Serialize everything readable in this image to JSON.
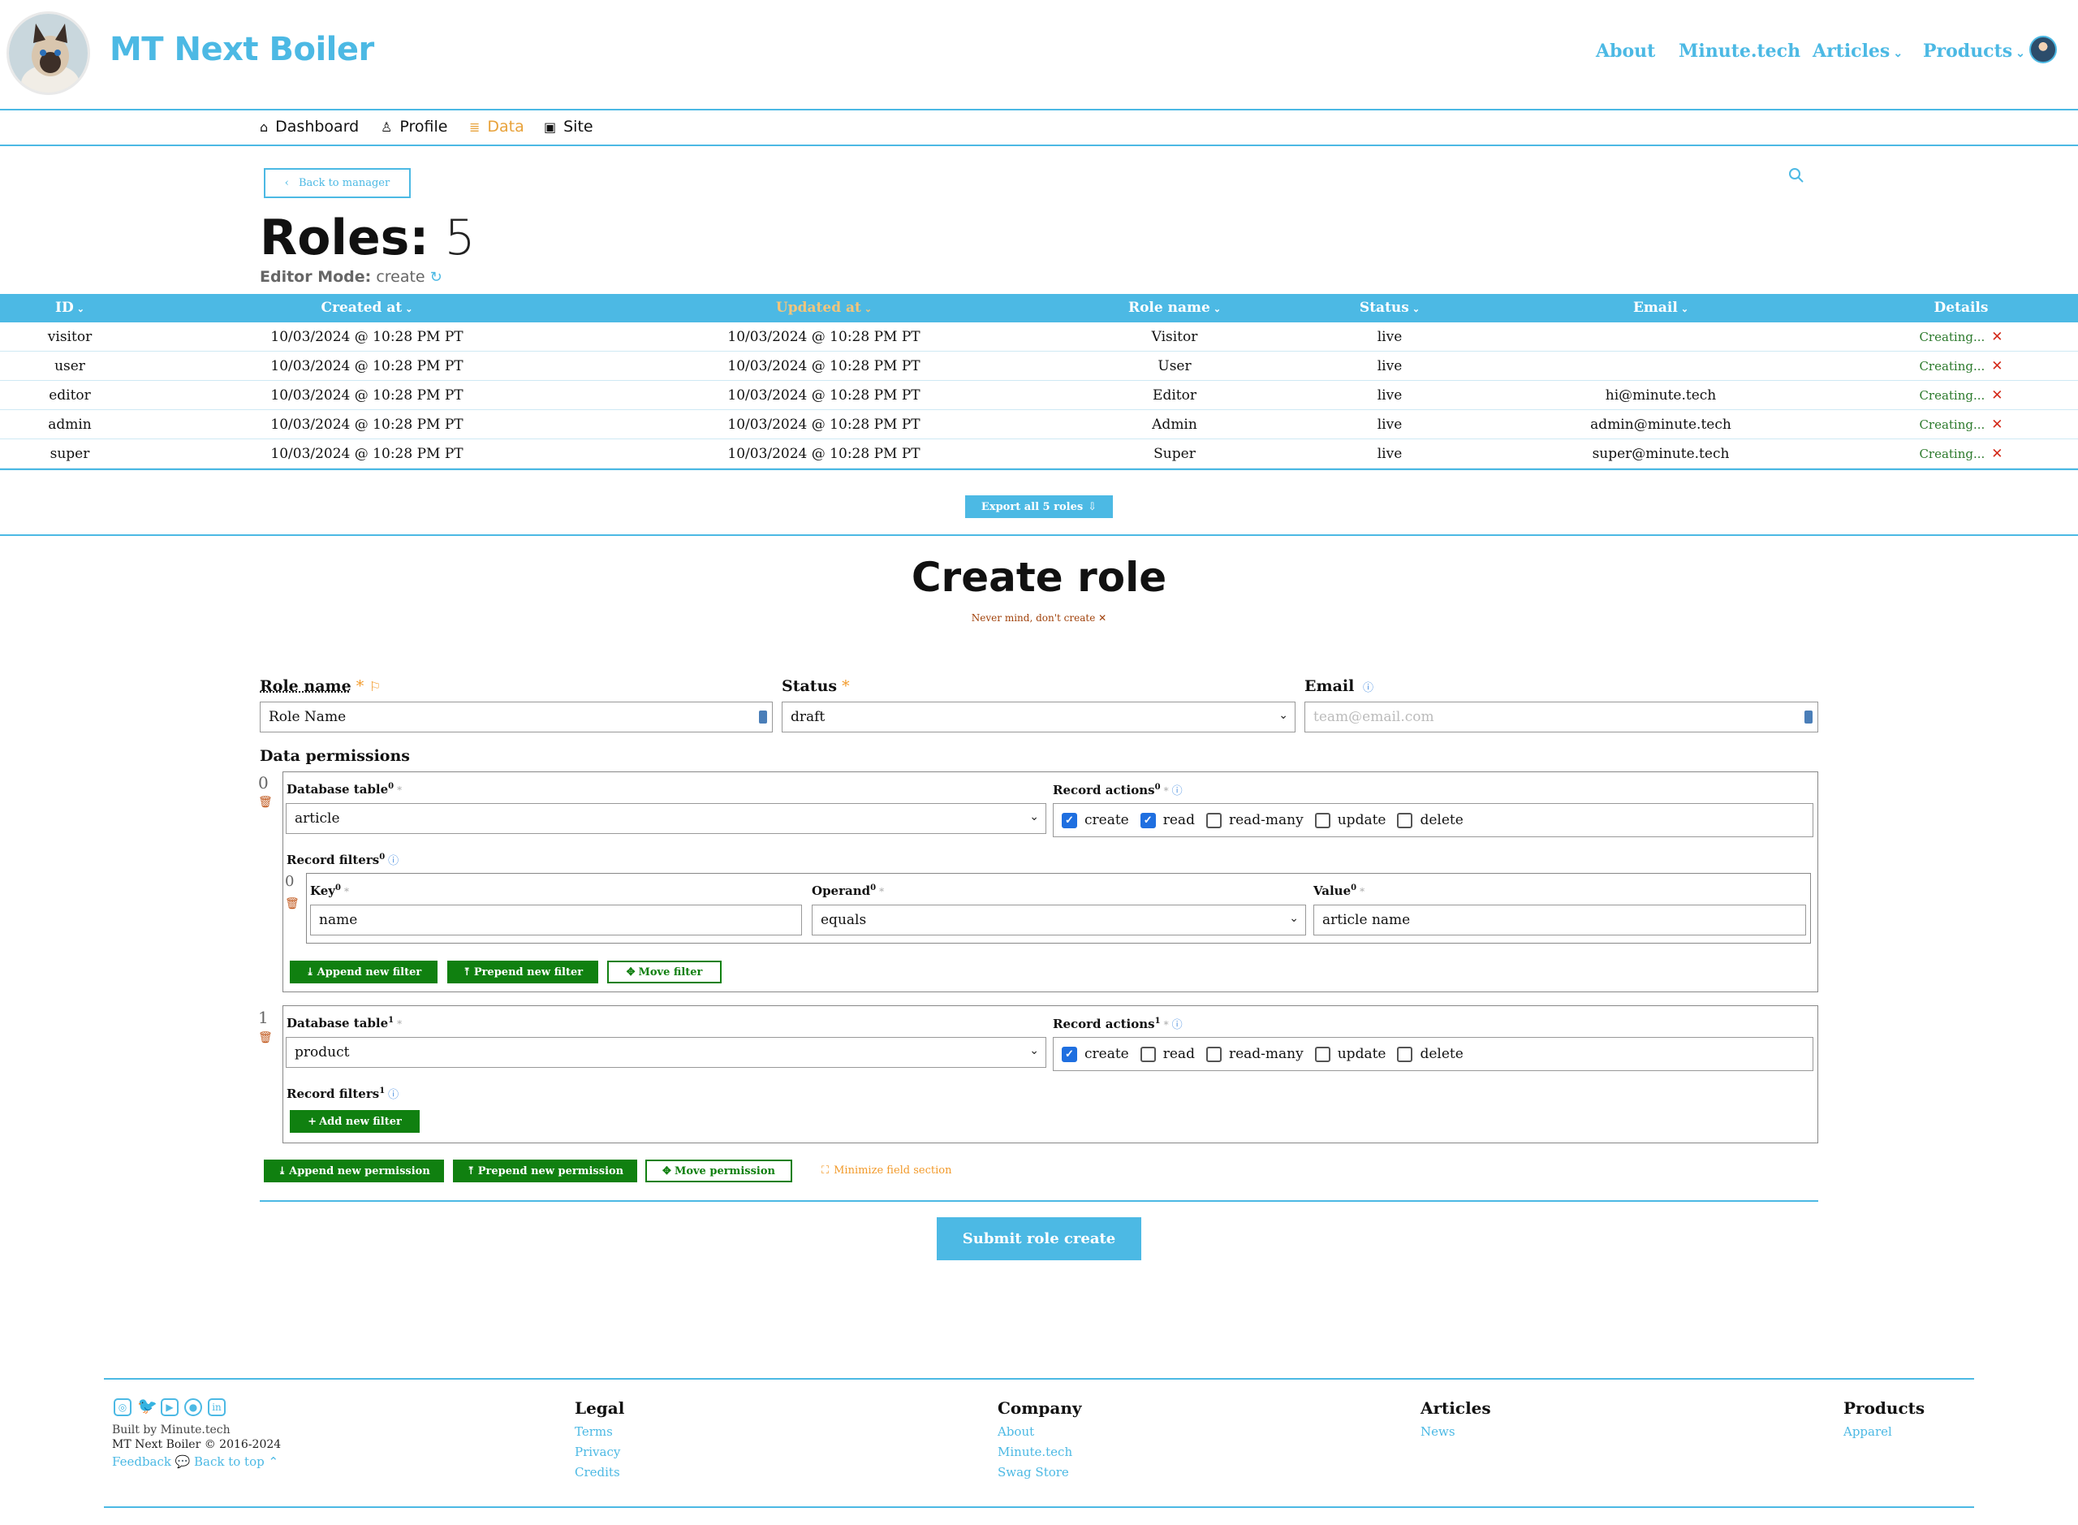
{
  "header": {
    "brand": "MT Next Boiler",
    "nav": [
      {
        "label": "About"
      },
      {
        "label": "Minute.tech"
      },
      {
        "label": "Articles",
        "chevron": "⌄"
      },
      {
        "label": "Products",
        "chevron": "⌄"
      }
    ]
  },
  "subnav": [
    {
      "icon": "home-icon",
      "label": "Dashboard"
    },
    {
      "icon": "user-icon",
      "label": "Profile"
    },
    {
      "icon": "database-icon",
      "label": "Data",
      "active": true
    },
    {
      "icon": "site-icon",
      "label": "Site"
    }
  ],
  "back_button": "Back to manager",
  "roles": {
    "title": "Roles:",
    "count": "5",
    "editor_mode_label": "Editor Mode:",
    "editor_mode_value": "create"
  },
  "table": {
    "columns": [
      "ID",
      "Created at",
      "Updated at",
      "Role name",
      "Status",
      "Email",
      "Details"
    ],
    "rows": [
      [
        "visitor",
        "10/03/2024 @ 10:28 PM PT",
        "10/03/2024 @ 10:28 PM PT",
        "Visitor",
        "live",
        "",
        "Creating..."
      ],
      [
        "user",
        "10/03/2024 @ 10:28 PM PT",
        "10/03/2024 @ 10:28 PM PT",
        "User",
        "live",
        "",
        "Creating..."
      ],
      [
        "editor",
        "10/03/2024 @ 10:28 PM PT",
        "10/03/2024 @ 10:28 PM PT",
        "Editor",
        "live",
        "hi@minute.tech",
        "Creating..."
      ],
      [
        "admin",
        "10/03/2024 @ 10:28 PM PT",
        "10/03/2024 @ 10:28 PM PT",
        "Admin",
        "live",
        "admin@minute.tech",
        "Creating..."
      ],
      [
        "super",
        "10/03/2024 @ 10:28 PM PT",
        "10/03/2024 @ 10:28 PM PT",
        "Super",
        "live",
        "super@minute.tech",
        "Creating..."
      ]
    ]
  },
  "export_button": "Export all 5 roles",
  "create": {
    "title": "Create role",
    "nevermind": "Never mind, don't create",
    "role_name_label": "Role name",
    "role_name_value": "Role Name",
    "status_label": "Status",
    "status_value": "draft",
    "email_label": "Email",
    "email_placeholder": "team@email.com",
    "data_permissions_label": "Data permissions",
    "permissions": [
      {
        "index": "0",
        "db_table_label": "Database table",
        "db_table_value": "article",
        "record_actions_label": "Record actions",
        "actions": [
          {
            "label": "create",
            "checked": true
          },
          {
            "label": "read",
            "checked": true
          },
          {
            "label": "read-many",
            "checked": false
          },
          {
            "label": "update",
            "checked": false
          },
          {
            "label": "delete",
            "checked": false
          }
        ],
        "record_filters_label": "Record filters",
        "filters": [
          {
            "index": "0",
            "key_label": "Key",
            "key_value": "name",
            "operand_label": "Operand",
            "operand_value": "equals",
            "value_label": "Value",
            "value_value": "article name"
          }
        ]
      },
      {
        "index": "1",
        "db_table_label": "Database table",
        "db_table_value": "product",
        "record_actions_label": "Record actions",
        "actions": [
          {
            "label": "create",
            "checked": true
          },
          {
            "label": "read",
            "checked": false
          },
          {
            "label": "read-many",
            "checked": false
          },
          {
            "label": "update",
            "checked": false
          },
          {
            "label": "delete",
            "checked": false
          }
        ],
        "record_filters_label": "Record filters",
        "filters": []
      }
    ],
    "append_filter": "Append new filter",
    "prepend_filter": "Prepend new filter",
    "move_filter": "Move filter",
    "add_filter": "Add new filter",
    "append_permission": "Append new permission",
    "prepend_permission": "Prepend new permission",
    "move_permission": "Move permission",
    "minimize": "Minimize field section",
    "submit": "Submit role create"
  },
  "footer": {
    "built_by": "Built by Minute.tech",
    "copyright": "MT Next Boiler © 2016-2024",
    "feedback": "Feedback",
    "back_to_top": "Back to top",
    "columns": [
      {
        "title": "Legal",
        "links": [
          "Terms",
          "Privacy",
          "Credits"
        ]
      },
      {
        "title": "Company",
        "links": [
          "About",
          "Minute.tech",
          "Swag Store"
        ]
      },
      {
        "title": "Articles",
        "links": [
          "News"
        ]
      },
      {
        "title": "Products",
        "links": [
          "Apparel"
        ]
      }
    ]
  },
  "colors": {
    "accent": "#4cb9e4",
    "active_nav": "#e8a23a",
    "green": "#108010",
    "danger": "#d42a1a"
  }
}
